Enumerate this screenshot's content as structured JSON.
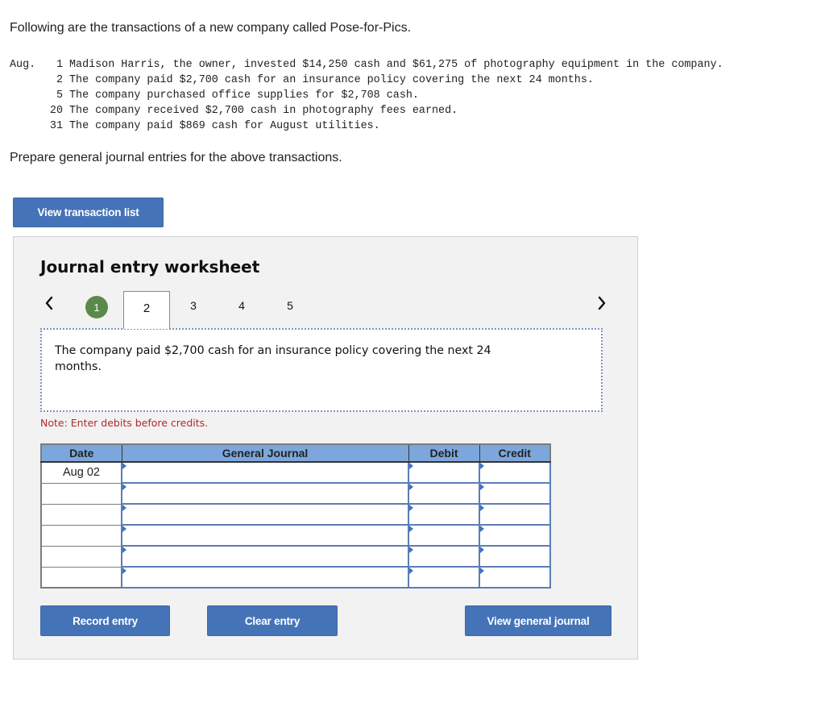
{
  "intro_text": "Following are the transactions of a new company called Pose-for-Pics.",
  "transactions": [
    {
      "month": "Aug.",
      "day": "1",
      "text": "Madison Harris, the owner, invested $14,250 cash and $61,275 of photography equipment in the company."
    },
    {
      "month": "",
      "day": "2",
      "text": "The company paid $2,700 cash for an insurance policy covering the next 24 months."
    },
    {
      "month": "",
      "day": "5",
      "text": "The company purchased office supplies for $2,708 cash."
    },
    {
      "month": "",
      "day": "20",
      "text": "The company received $2,700 cash in photography fees earned."
    },
    {
      "month": "",
      "day": "31",
      "text": "The company paid $869 cash for August utilities."
    }
  ],
  "prompt_text": "Prepare general journal entries for the above transactions.",
  "buttons": {
    "view_transaction_list": "View transaction list",
    "record_entry": "Record entry",
    "clear_entry": "Clear entry",
    "view_general_journal": "View general journal"
  },
  "worksheet": {
    "title": "Journal entry worksheet",
    "nav_prev_icon": "‹",
    "nav_next_icon": "›",
    "tabs": [
      {
        "label": "1",
        "state": "completed"
      },
      {
        "label": "2",
        "state": "active"
      },
      {
        "label": "3",
        "state": "default"
      },
      {
        "label": "4",
        "state": "default"
      },
      {
        "label": "5",
        "state": "default"
      }
    ],
    "description": "The company paid $2,700 cash for an insurance policy covering the next 24 months.",
    "note": "Note: Enter debits before credits.",
    "table": {
      "headers": [
        "Date",
        "General Journal",
        "Debit",
        "Credit"
      ],
      "rows": [
        {
          "date": "Aug 02",
          "account": "",
          "debit": "",
          "credit": ""
        },
        {
          "date": "",
          "account": "",
          "debit": "",
          "credit": ""
        },
        {
          "date": "",
          "account": "",
          "debit": "",
          "credit": ""
        },
        {
          "date": "",
          "account": "",
          "debit": "",
          "credit": ""
        },
        {
          "date": "",
          "account": "",
          "debit": "",
          "credit": ""
        },
        {
          "date": "",
          "account": "",
          "debit": "",
          "credit": ""
        }
      ]
    }
  },
  "colors": {
    "button_blue": "#4573b8",
    "completed_tab_green": "#5a8a4a",
    "header_blue": "#7da7dc",
    "note_red": "#b02a2a"
  }
}
